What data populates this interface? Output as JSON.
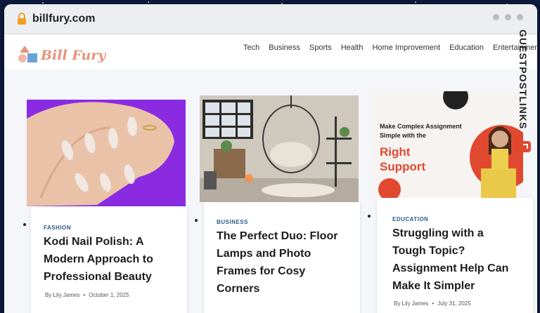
{
  "browser": {
    "url": "billfury.com"
  },
  "site": {
    "logo_text": "Bill Fury",
    "nav": [
      "Tech",
      "Business",
      "Sports",
      "Health",
      "Home Improvement",
      "Education",
      "Entertainment"
    ]
  },
  "side_banner": {
    "text": "GUESTPOSTLINKS"
  },
  "articles": [
    {
      "category": "FASHION",
      "title_lines": [
        "Kodi Nail Polish: A",
        "Modern Approach to",
        "Professional Beauty"
      ],
      "author": "By Lily James",
      "date": "October 1, 2025"
    },
    {
      "category": "BUSINESS",
      "title_lines": [
        "The Perfect Duo: Floor",
        "Lamps and Photo",
        "Frames for Cosy",
        "Corners"
      ]
    },
    {
      "category": "EDUCATION",
      "title_lines": [
        "Struggling with a",
        "Tough Topic?",
        "Assignment Help Can",
        "Make It Simpler"
      ],
      "author": "By Lily James",
      "date": "July 31, 2025",
      "image_text": {
        "line1": "Make Complex Assignment",
        "line2": "Simple with the",
        "highlight1": "Right",
        "highlight2": "Support"
      }
    }
  ],
  "colors": {
    "page_bg": "#f4f6f9",
    "accent_orange": "#e8927c",
    "purple": "#8a2be2",
    "highlight_red": "#e0492f",
    "category_blue": "#2c5a8a"
  }
}
